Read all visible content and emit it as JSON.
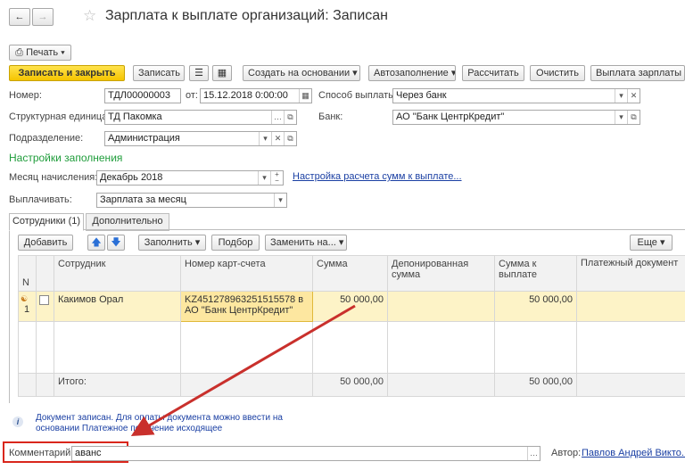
{
  "window": {
    "title": "Зарплата к выплате организаций: Записан",
    "back_icon": "arrow-left-icon",
    "forward_icon": "arrow-right-icon",
    "favorite_icon": "star-icon"
  },
  "print_menu": {
    "label": "Печать"
  },
  "toolbar": {
    "save_close": "Записать и закрыть",
    "save": "Записать",
    "create_based": "Создать на основании",
    "autofill": "Автозаполнение",
    "calculate": "Рассчитать",
    "clear": "Очистить",
    "payout": "Выплата зарплаты Р"
  },
  "form": {
    "number_label": "Номер:",
    "number_value": "ТДЛ00000003",
    "date_label": "от:",
    "date_value": "15.12.2018  0:00:00",
    "payment_method_label": "Способ выплаты:",
    "payment_method_value": "Через банк",
    "struct_unit_label": "Структурная единица:",
    "struct_unit_value": "ТД Пакомка",
    "bank_label": "Банк:",
    "bank_value": "АО \"Банк ЦентрКредит\"",
    "division_label": "Подразделение:",
    "division_value": "Администрация",
    "fill_settings_title": "Настройки заполнения",
    "accrual_month_label": "Месяц начисления:",
    "accrual_month_value": "Декабрь 2018",
    "calc_settings_link": "Настройка расчета сумм к выплате...",
    "pay_label": "Выплачивать:",
    "pay_value": "Зарплата за месяц"
  },
  "tabs": [
    {
      "label": "Сотрудники (1)"
    },
    {
      "label": "Дополнительно"
    }
  ],
  "table_toolbar": {
    "add": "Добавить",
    "fill": "Заполнить",
    "select": "Подбор",
    "replace": "Заменить на...",
    "more": "Еще"
  },
  "table": {
    "n_header": "N",
    "headers": [
      "Сотрудник",
      "Номер карт-счета",
      "Сумма",
      "Депонированная сумма",
      "Сумма к выплате",
      "Платежный документ"
    ],
    "row": {
      "num": "1",
      "employee": "Какимов Орал",
      "account": "KZ451278963251515578 в АО \"Банк ЦентрКредит\"",
      "sum": "50 000,00",
      "deposited": "",
      "to_pay": "50 000,00",
      "payment_doc": ""
    },
    "totals": {
      "label": "Итого:",
      "sum": "50 000,00",
      "to_pay": "50 000,00"
    }
  },
  "info": {
    "text": "Документ записан. Для оплаты документа можно ввести на основании Платежное поручение исходящее"
  },
  "footer": {
    "comment_label": "Комментарий:",
    "comment_value": "аванс",
    "author_label": "Автор:",
    "author_value": "Павлов Андрей Викто..."
  },
  "colors": {
    "highlight_box": "#d9261c",
    "arrow": "#c9302c",
    "primary_button": "#f5c400",
    "selected_row": "#fdf3c7",
    "link": "#1a3fa3",
    "section_title": "#1e9c3a"
  }
}
